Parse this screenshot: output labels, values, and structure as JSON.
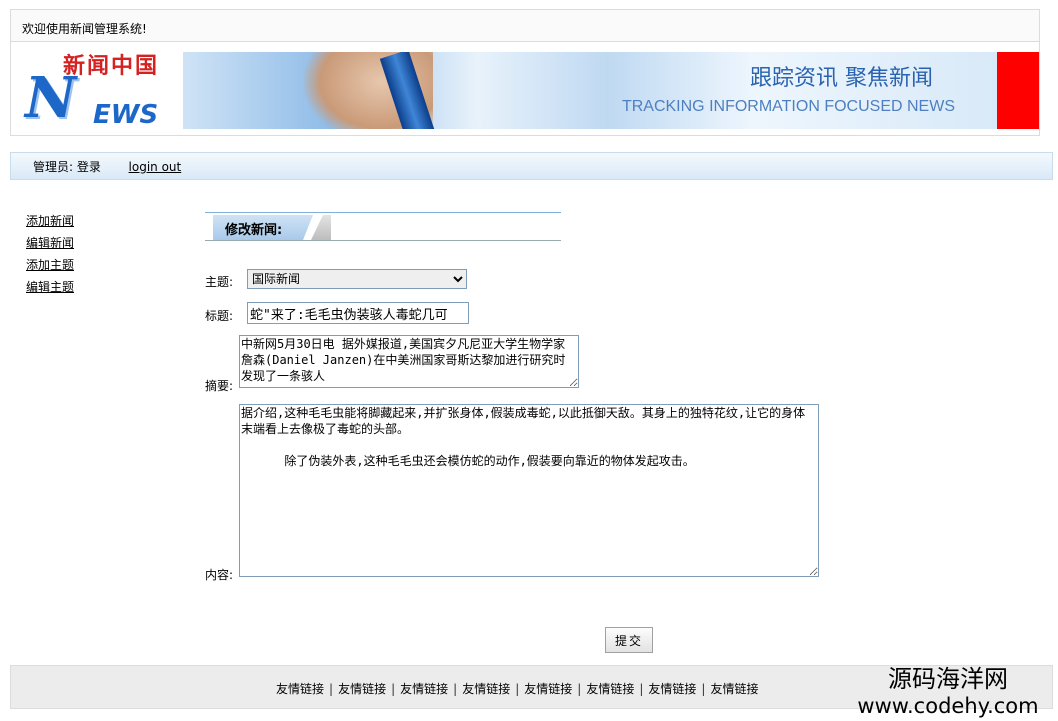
{
  "topbar": {
    "welcome": "欢迎使用新闻管理系统!"
  },
  "banner": {
    "logo_cn": "新闻中国",
    "logo_n": "N",
    "logo_ews": "EWS",
    "slogan_cn": "跟踪资讯 聚焦新闻",
    "slogan_en": "TRACKING INFORMATION FOCUSED NEWS",
    "accent_color": "#ff0000"
  },
  "admin": {
    "label": "管理员:",
    "login": "登录",
    "logout": "login out"
  },
  "sidebar": {
    "items": [
      {
        "label": "添加新闻"
      },
      {
        "label": "编辑新闻"
      },
      {
        "label": "添加主题"
      },
      {
        "label": "编辑主题"
      }
    ]
  },
  "form": {
    "section_title": "修改新闻:",
    "topic_label": "主题:",
    "topic_value": "国际新闻",
    "title_label": "标题:",
    "title_value": "蛇\"来了:毛毛虫伪装骇人毒蛇几可",
    "summary_label": "摘要:",
    "summary_value": "中新网5月30日电 据外媒报道,美国宾夕凡尼亚大学生物学家詹森(Daniel Janzen)在中美洲国家哥斯达黎加进行研究时发现了一条骇人",
    "content_label": "内容:",
    "content_value": "据介绍,这种毛毛虫能将脚藏起来,并扩张身体,假装成毒蛇,以此抵御天敌。其身上的独特花纹,让它的身体末端看上去像极了毒蛇的头部。\n\n      除了伪装外表,这种毛毛虫还会模仿蛇的动作,假装要向靠近的物体发起攻击。",
    "submit_label": "提交"
  },
  "footer": {
    "links": [
      "友情链接",
      "友情链接",
      "友情链接",
      "友情链接",
      "友情链接",
      "友情链接",
      "友情链接",
      "友情链接"
    ],
    "separator": "|"
  },
  "watermark": {
    "cn": "源码海洋网",
    "en": "www.codehy.com"
  }
}
